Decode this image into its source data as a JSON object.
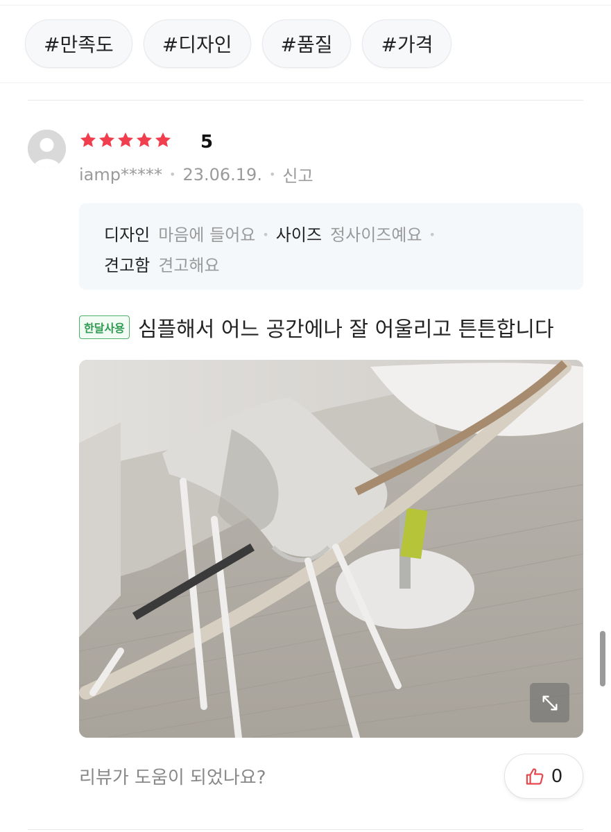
{
  "tags": [
    "#만족도",
    "#디자인",
    "#품질",
    "#가격"
  ],
  "review": {
    "rating": "5",
    "star_count": 5,
    "star_color": "#f03e4e",
    "user": "iamp*****",
    "date": "23.06.19.",
    "report_label": "신고",
    "attributes": [
      {
        "key": "디자인",
        "value": "마음에 들어요"
      },
      {
        "key": "사이즈",
        "value": "정사이즈예요"
      },
      {
        "key": "견고함",
        "value": "견고해요"
      }
    ],
    "badge": "한달사용",
    "badge_color": "#2e9b50",
    "text": "심플해서 어느 공간에나 잘 어울리고 튼튼합니다",
    "photo_icon": "expand-icon"
  },
  "helpful": {
    "question": "리뷰가 도움이 되었나요?",
    "count": "0",
    "icon": "thumbs-up-icon",
    "accent": "#e5484d"
  }
}
